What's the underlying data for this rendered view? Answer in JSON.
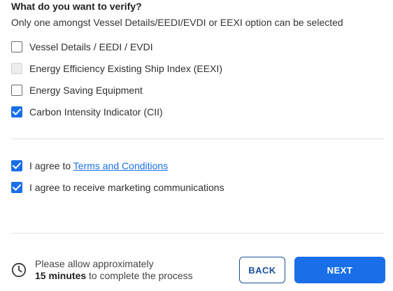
{
  "form": {
    "question": "What do you want to verify?",
    "subtitle": "Only one amongst Vessel Details/EEDI/EVDI or EEXI option can be selected",
    "options": [
      {
        "label": "Vessel Details / EEDI / EVDI",
        "checked": false,
        "disabled": false
      },
      {
        "label": "Energy Efficiency Existing Ship Index (EEXI)",
        "checked": false,
        "disabled": true
      },
      {
        "label": "Energy Saving Equipment",
        "checked": false,
        "disabled": false
      },
      {
        "label": "Carbon Intensity Indicator (CII)",
        "checked": true,
        "disabled": false
      }
    ]
  },
  "agreements": {
    "terms_prefix": "I agree to ",
    "terms_link": "Terms and Conditions",
    "terms_checked": true,
    "marketing_label": "I agree to receive marketing communications",
    "marketing_checked": true
  },
  "footer": {
    "notice_line1": "Please allow approximately",
    "notice_duration": "15 minutes",
    "notice_rest": " to complete the process",
    "back_label": "BACK",
    "next_label": "NEXT"
  },
  "colors": {
    "accent": "#1a6fe8",
    "back_border": "#1a4f9c"
  },
  "icons": {
    "check": "check-icon",
    "clock": "clock-icon"
  }
}
